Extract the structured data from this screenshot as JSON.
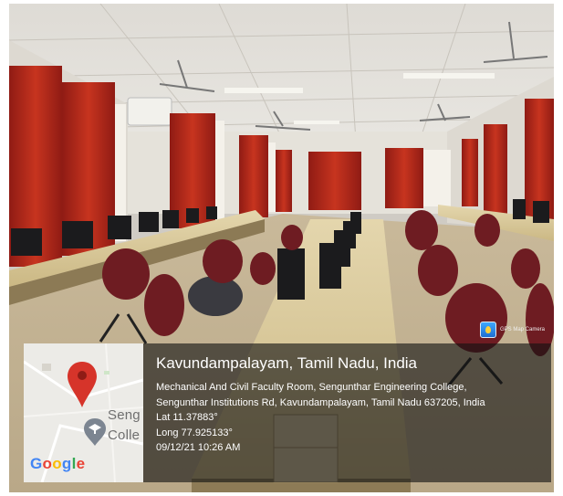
{
  "badge": {
    "label": "GPS Map Camera",
    "icon": "camera-pin-icon"
  },
  "map": {
    "label_line1": "Seng",
    "label_line2": "Colle",
    "pin_icon": "map-pin-icon",
    "grad_icon": "graduation-cap-icon",
    "logo_letters": [
      "G",
      "o",
      "o",
      "g",
      "l",
      "e"
    ]
  },
  "location": {
    "title": "Kavundampalayam, Tamil Nadu, India",
    "address_line1": "Mechanical And Civil Faculty Room, Sengunthar Engineering College,",
    "address_line2": "Sengunthar Institutions Rd, Kavundampalayam, Tamil Nadu 637205, India",
    "lat": "Lat 11.37883°",
    "long": "Long 77.925133°",
    "timestamp": "09/12/21 10:26 AM"
  },
  "colors": {
    "curtain": "#b3261c",
    "chair": "#6e1c22",
    "desk": "#d9c89b",
    "overlay": "#121212"
  }
}
